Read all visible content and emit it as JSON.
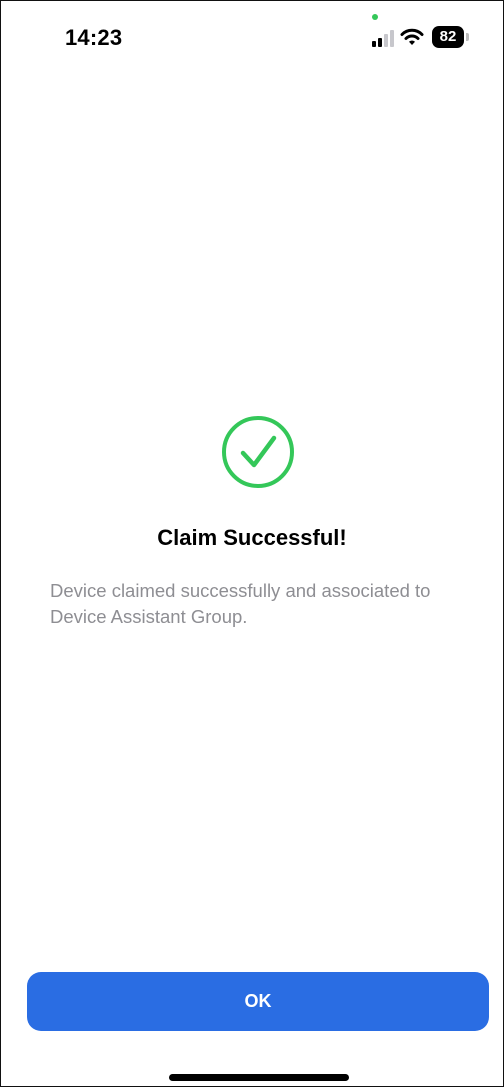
{
  "status_bar": {
    "time": "14:23",
    "signal_icon": "cellular-signal-icon",
    "wifi_icon": "wifi-icon",
    "battery_level": "82",
    "privacy_dot_color": "#34c759"
  },
  "content": {
    "icon": "check-circle-icon",
    "icon_color": "#34c759",
    "title": "Claim Successful!",
    "message": "Device claimed successfully and associated to Device Assistant Group."
  },
  "actions": {
    "ok_label": "OK",
    "button_color": "#2a6de3"
  }
}
